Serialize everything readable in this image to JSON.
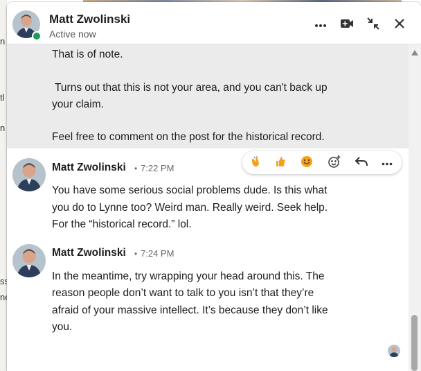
{
  "header": {
    "name": "Matt Zwolinski",
    "status": "Active now",
    "icons": {
      "more": "more-horizontal-icon",
      "video": "video-camera-icon",
      "minimize": "minimize-arrows-icon",
      "close": "close-icon"
    }
  },
  "colors": {
    "presence": "#1a9e5a",
    "previous_message_bg": "#ebebeb",
    "reaction_yellow": "#f2a21b"
  },
  "previous_message": {
    "lines": [
      "That is of note.",
      " Turns out that this is not your area, and you can't back up",
      "your claim.",
      "Feel free to comment on the post for the historical record."
    ]
  },
  "reaction_bar": {
    "icons": [
      "clap-icon",
      "thumbs-up-icon",
      "smile-icon",
      "add-reaction-icon",
      "reply-icon",
      "more-horizontal-icon"
    ]
  },
  "messages": [
    {
      "sender": "Matt Zwolinski",
      "separator": "•",
      "time": "7:22 PM",
      "lines": [
        "You have some serious social problems dude. Is this what",
        "you do to Lynne too? Weird man. Really weird. Seek help.",
        "For the “historical record.” lol."
      ]
    },
    {
      "sender": "Matt Zwolinski",
      "separator": "•",
      "time": "7:24 PM",
      "lines": [
        "In the meantime, try wrapping your head around this. The",
        "reason people don’t want to talk to you isn’t that they’re",
        "afraid of your massive intellect. It’s because they don’t like",
        "you."
      ]
    }
  ],
  "background_fragments": [
    "n",
    "tl",
    "n",
    "ss",
    "ne"
  ]
}
